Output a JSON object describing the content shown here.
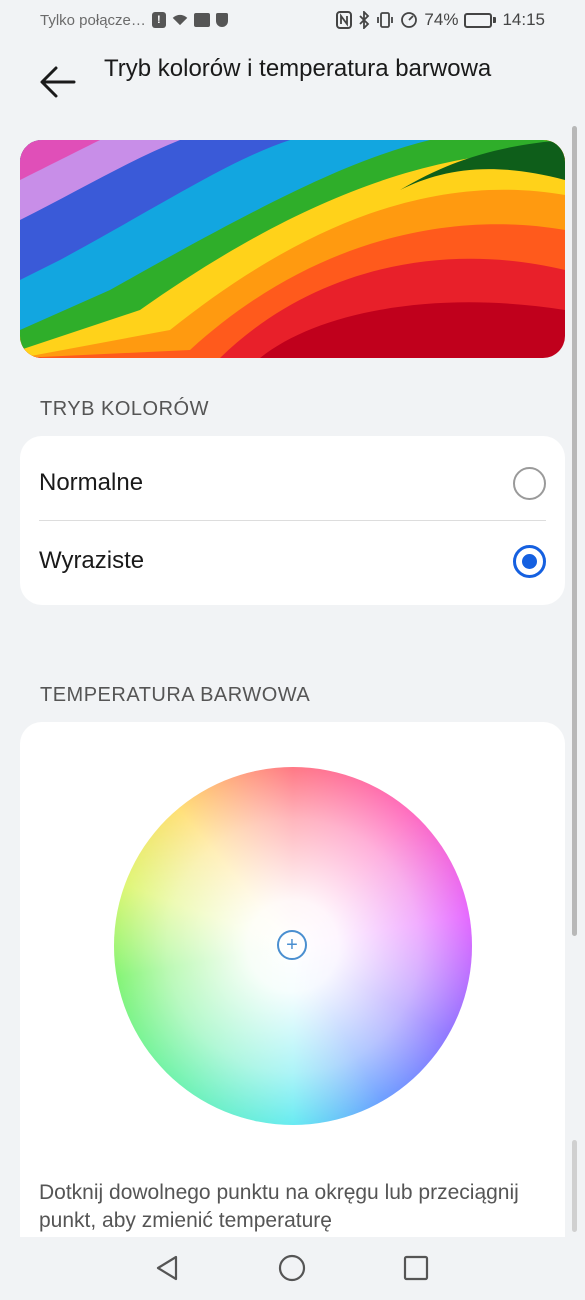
{
  "status_bar": {
    "carrier": "Tylko połącze…",
    "battery_percent": "74%",
    "battery_level": 0.74,
    "time": "14:15"
  },
  "header": {
    "title": "Tryb kolorów i temperatura barwowa",
    "back_icon": "arrow-left-icon"
  },
  "color_mode": {
    "section_label": "TRYB KOLORÓW",
    "options": [
      {
        "label": "Normalne",
        "selected": false
      },
      {
        "label": "Wyraziste",
        "selected": true
      }
    ]
  },
  "temperature": {
    "section_label": "TEMPERATURA BARWOWA",
    "hint": "Dotknij dowolnego punktu na okręgu lub przeciągnij punkt, aby zmienić temperaturę"
  },
  "colors": {
    "accent": "#1560e0",
    "background": "#f1f3f5",
    "card": "#ffffff"
  },
  "nav_bar": {
    "icons": [
      "back-triangle-icon",
      "home-circle-icon",
      "recents-square-icon"
    ]
  }
}
